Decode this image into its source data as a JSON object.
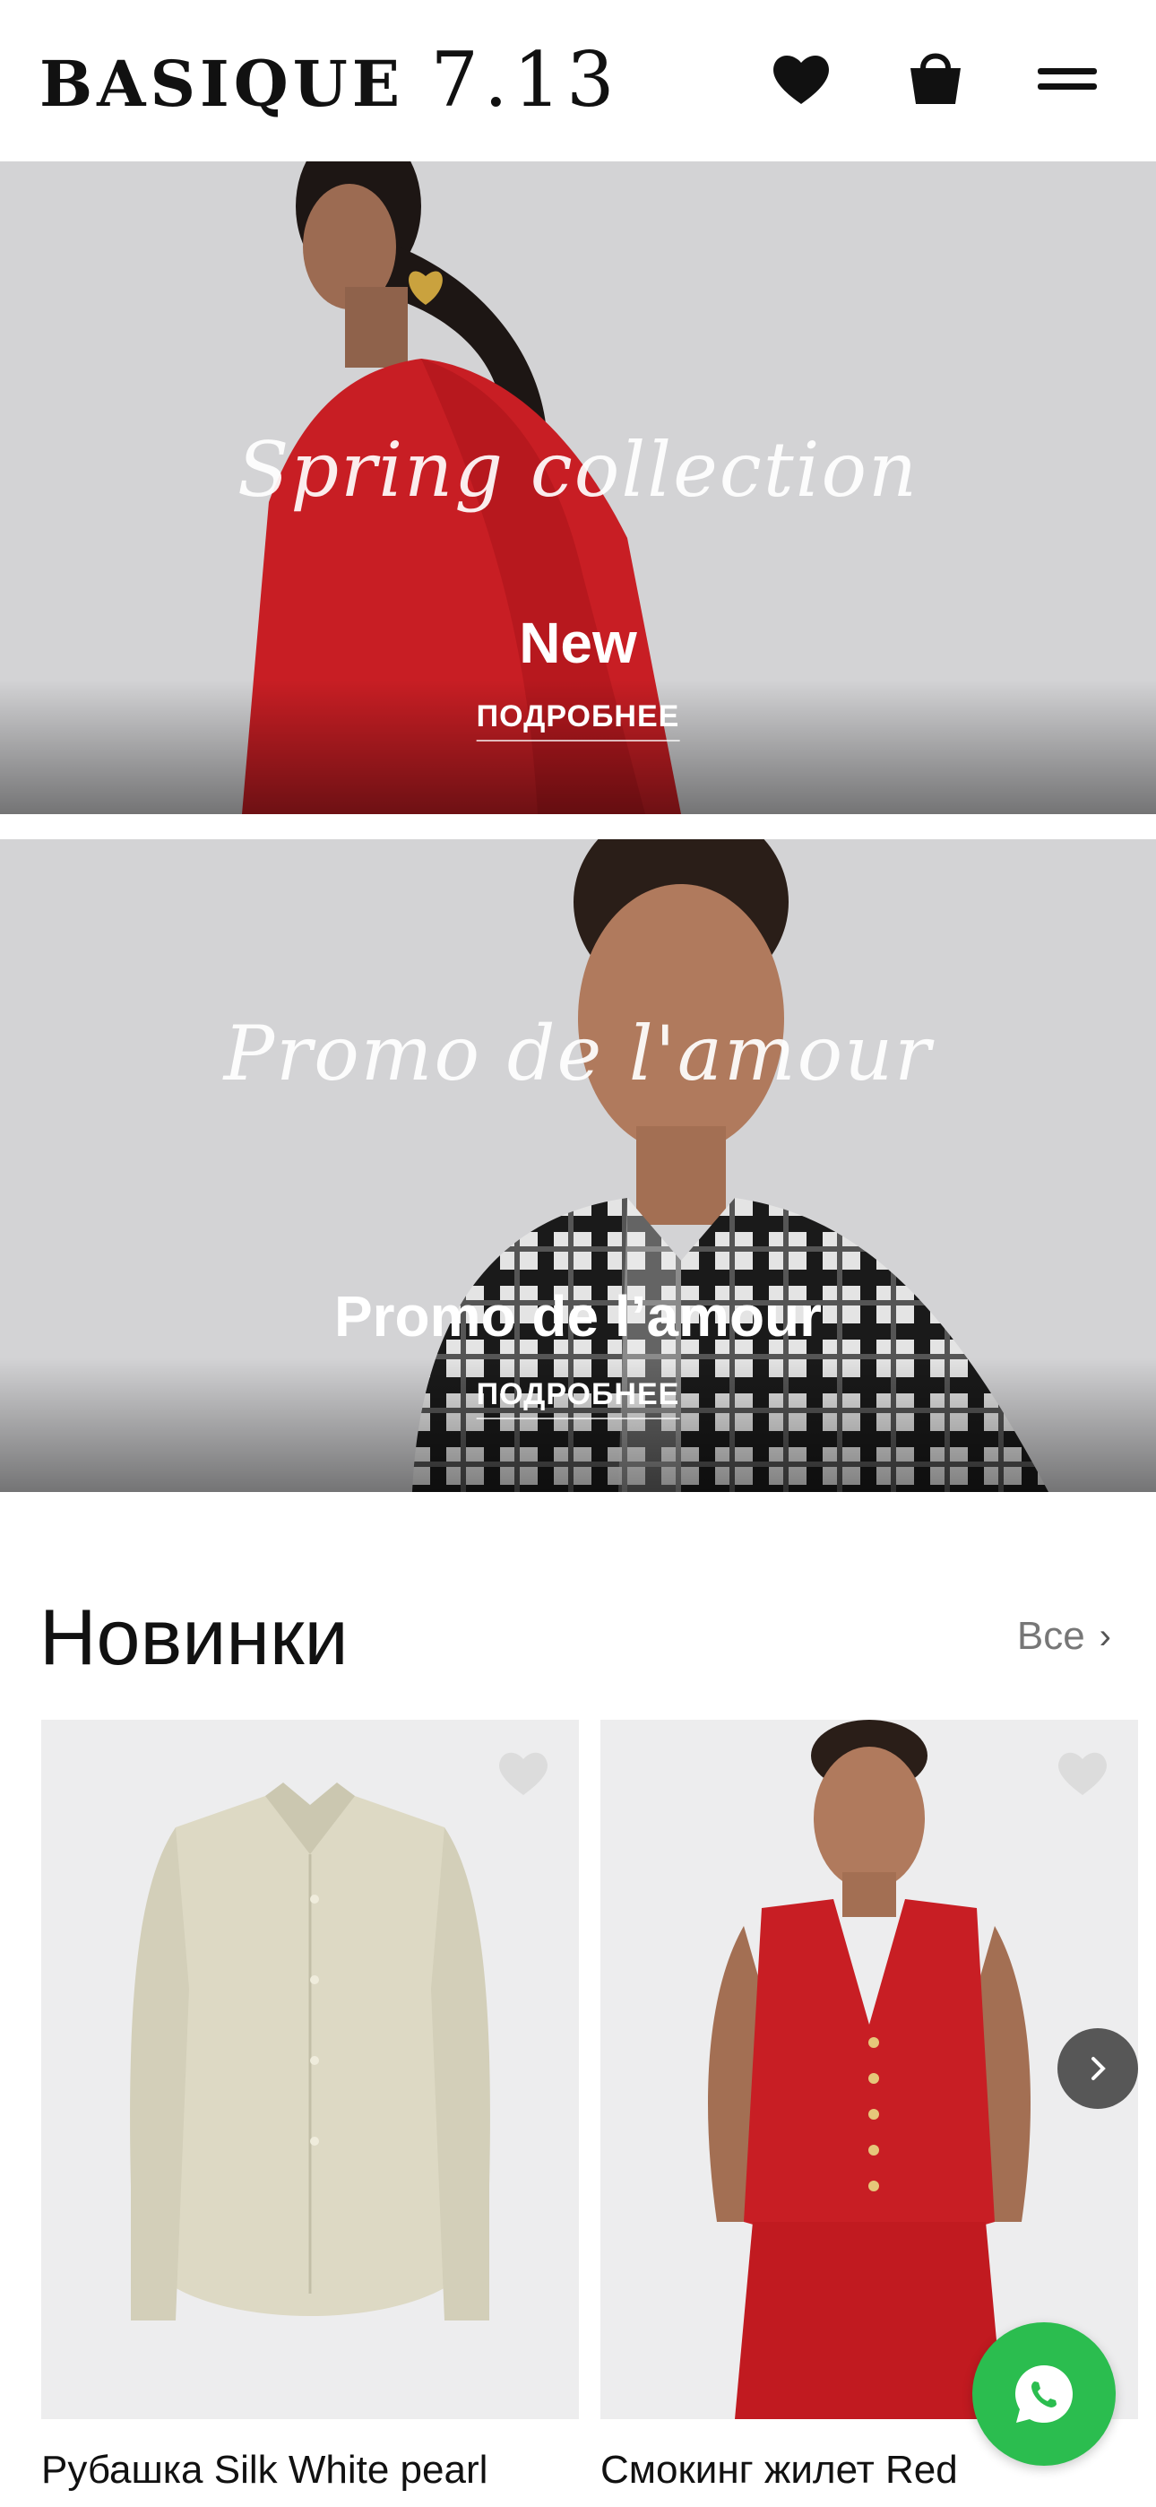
{
  "header": {
    "logo_word": "BASIQUE",
    "logo_num": "7.13",
    "icons": [
      "heart-icon",
      "shopping-bag-icon",
      "menu-icon"
    ]
  },
  "banners": [
    {
      "script": "Spring collection",
      "title": "New",
      "link": "ПОДРОБНЕЕ"
    },
    {
      "script": "Promo de l'amour",
      "title": "Promo de l’amour",
      "link": "ПОДРОБНЕЕ"
    }
  ],
  "section": {
    "title": "Новинки",
    "all_label": "Все"
  },
  "products": [
    {
      "name": "Рубашка Silk White pearl"
    },
    {
      "name": "Смокинг жилет Red"
    }
  ],
  "colors": {
    "brand_dark": "#111111",
    "product_red": "#c81e24",
    "whatsapp_green": "#2bbd4f"
  }
}
